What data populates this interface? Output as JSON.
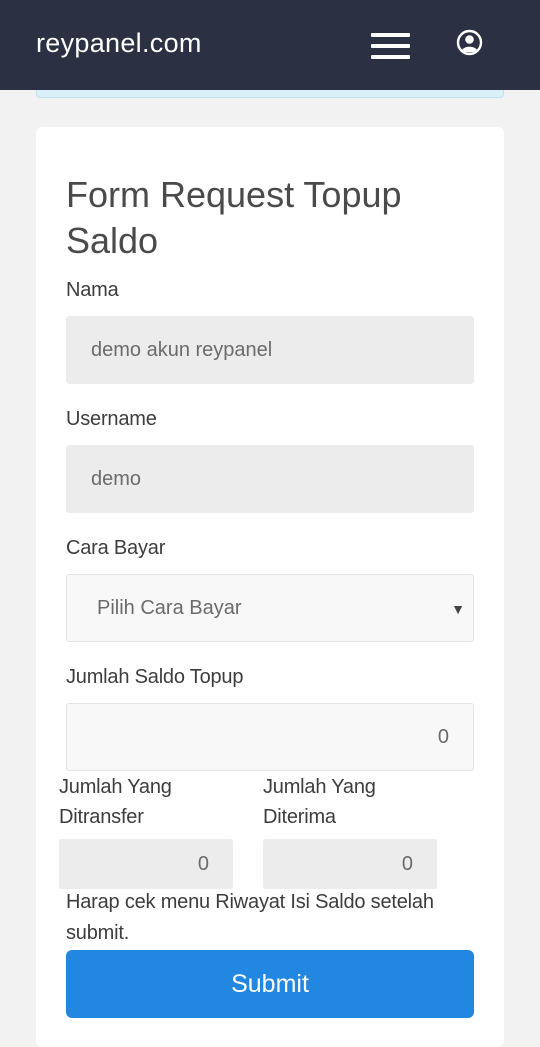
{
  "header": {
    "brand": "reypanel.com",
    "menu_icon": "hamburger-menu-icon",
    "user_icon": "user-circle-icon",
    "background": "#2b3142"
  },
  "form": {
    "title": "Form Request Topup Saldo",
    "nama": {
      "label": "Nama",
      "value": "demo akun reypanel"
    },
    "username": {
      "label": "Username",
      "value": "demo"
    },
    "cara_bayar": {
      "label": "Cara Bayar",
      "selected": "Pilih Cara Bayar"
    },
    "jumlah_saldo": {
      "label": "Jumlah Saldo Topup",
      "value": "0"
    },
    "jumlah_ditransfer": {
      "label_line1": "Jumlah Yang",
      "label_line2": "Ditransfer",
      "value": "0"
    },
    "jumlah_diterima": {
      "label_line1": "Jumlah Yang",
      "label_line2": "Diterima",
      "value": "0"
    },
    "note": "Harap cek menu Riwayat Isi Saldo setelah submit.",
    "submit_label": "Submit",
    "accent": "#2287e0"
  }
}
